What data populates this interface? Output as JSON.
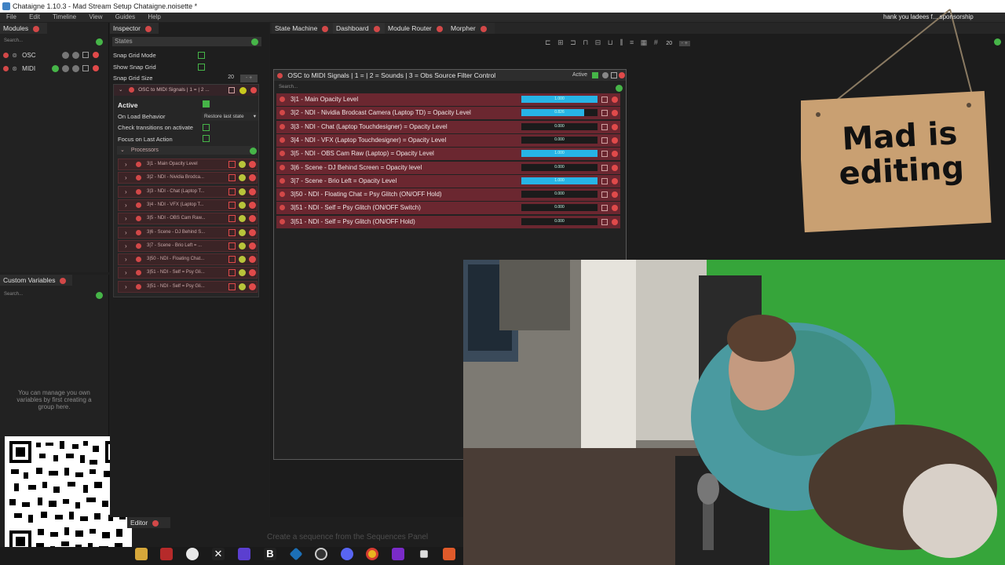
{
  "title": "Chataigne 1.10.3 - Mad Stream Setup Chataigne.noisette *",
  "overlay_text": "hank you ladees f... sponsorship",
  "menu": [
    "File",
    "Edit",
    "Timeline",
    "View",
    "Guides",
    "Help"
  ],
  "modules": {
    "tab": "Modules",
    "search": "Search...",
    "items": [
      "OSC",
      "MIDI"
    ]
  },
  "custom_vars": {
    "tab": "Custom Variables",
    "search": "Search...",
    "empty": "You can manage you own variables by first creating a group here."
  },
  "inspector": {
    "tab": "Inspector",
    "states_header": "States",
    "snap_mode": "Snap Grid Mode",
    "show_snap": "Show Snap Grid",
    "snap_size_label": "Snap Grid Size",
    "snap_size_value": "20",
    "state_name": "OSC to MIDI Signals | 1 = | 2 ...",
    "active": "Active",
    "on_load": "On Load Behavior",
    "on_load_value": "Restore last state",
    "check_transitions": "Check transitions on activate",
    "focus_last": "Focus on Last Action",
    "processors": "Processors",
    "proc_items": [
      "3|1 - Main Opacity Level",
      "3|2 - NDI - Nividia Brodca...",
      "3|3 - NDI - Chat (Laptop T...",
      "3|4 - NDI - VFX (Laptop T...",
      "3|5 - NDI - OBS Cam Raw...",
      "3|6 - Scene - DJ Behind S...",
      "3|7 - Scene - Brio Left = ...",
      "3|50 - NDI - Floating Chat...",
      "3|51 - NDI - Self = Psy Gli...",
      "3|51 - NDI - Self = Psy Gli..."
    ]
  },
  "tabs": [
    "State Machine",
    "Dashboard",
    "Module Router",
    "Morpher"
  ],
  "toolbar_value": "20",
  "state_box": {
    "title": "OSC to MIDI Signals | 1 =  | 2 = Sounds | 3 = Obs Source Filter Control",
    "active_label": "Active",
    "search": "Search...",
    "rows": [
      {
        "label": "3|1 - Main Opacity Level",
        "value": "1.000",
        "level": 1.0
      },
      {
        "label": "3|2 - NDI - Nividia Brodcast Camera (Laptop TD) = Opacity Level",
        "value": "0.826",
        "level": 0.826
      },
      {
        "label": "3|3 - NDI - Chat (Laptop Touchdesigner) = Opacity Level",
        "value": "0.000",
        "level": 0
      },
      {
        "label": "3|4 - NDI - VFX (Laptop Touchdesigner) = Opacity Level",
        "value": "0.000",
        "level": 0
      },
      {
        "label": "3|5 - NDI - OBS Cam Raw (Laptop) = Opacity Level",
        "value": "1.000",
        "level": 1.0
      },
      {
        "label": "3|6 - Scene - DJ Behind Screen = Opacity level",
        "value": "0.000",
        "level": 0
      },
      {
        "label": "3|7 - Scene - Brio Left = Opacity Level",
        "value": "1.000",
        "level": 1.0
      },
      {
        "label": "3|50 - NDI - Floating Chat = Psy Glitch (ON/OFF Hold)",
        "value": "0.000",
        "level": 0
      },
      {
        "label": "3|51 - NDI - Self = Psy Glitch (ON/OFF Switch)",
        "value": "0.000",
        "level": 0
      },
      {
        "label": "3|51 - NDI - Self = Psy Glitch (ON/OFF Hold)",
        "value": "0.000",
        "level": 0
      }
    ]
  },
  "sign_text": "Mad is editing",
  "sequence_editor": {
    "tab": "Editor",
    "hint": "Create a sequence from the Sequences Panel"
  },
  "colors": {
    "accent_green": "#46b548",
    "accent_red": "#d24848",
    "row_red": "#6b2730",
    "bar_blue": "#27b4e6"
  }
}
